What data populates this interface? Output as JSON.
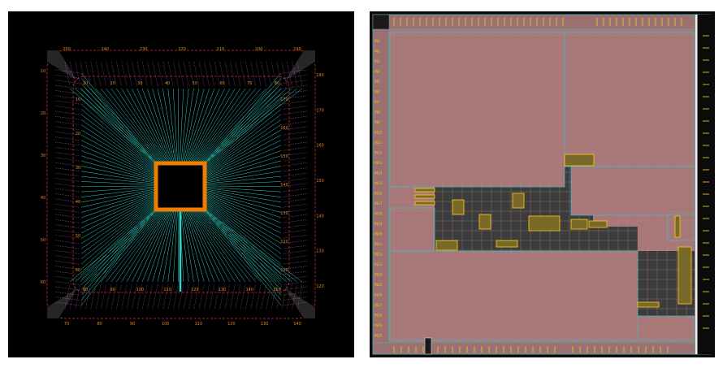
{
  "left_panel": {
    "title": "",
    "colors": {
      "background": "#000000",
      "bond_wire": "#2fd3c8",
      "die": "#f07c00",
      "pad_ring": "#e04040",
      "pin_outline": "#c878c8",
      "label": "#e08a1e"
    },
    "labels": {
      "top_outer": [
        "250",
        "240",
        "230",
        "220",
        "210",
        "200",
        "190"
      ],
      "top_inner": [
        "10",
        "20",
        "30",
        "40",
        "50",
        "60",
        "70",
        "80"
      ],
      "bottom_outer": [
        "70",
        "80",
        "90",
        "100",
        "110",
        "120",
        "130",
        "140"
      ],
      "bottom_inner": [
        "80",
        "90",
        "100",
        "110",
        "120",
        "130",
        "140",
        "150"
      ],
      "left_outer": [
        "10",
        "20",
        "30",
        "40",
        "50",
        "60"
      ],
      "left_inner": [
        "10",
        "20",
        "30",
        "40",
        "50",
        "60"
      ],
      "right_outer": [
        "180",
        "170",
        "160",
        "150",
        "140",
        "130",
        "120"
      ],
      "right_inner": [
        "170",
        "160",
        "150",
        "140",
        "130",
        "120",
        "110"
      ]
    }
  },
  "right_panel": {
    "title": "",
    "colors": {
      "background": "#0b0b0b",
      "macro_fill": "#a87878",
      "core_fill": "#3c3c3c",
      "outline": "#3fb8c8",
      "cell": "#f0c020"
    },
    "pin_labels_left": [
      "IN1",
      "IN2",
      "IN3",
      "IN4",
      "IN5",
      "IN6",
      "IN7",
      "IN8",
      "IN9",
      "IN10",
      "IN11",
      "IN12",
      "IN13",
      "IN14",
      "IN15",
      "IN16",
      "IN17",
      "IN18",
      "IN19",
      "IN20",
      "IN21",
      "IN22",
      "IN23",
      "IN24",
      "IN25",
      "IN26",
      "IN27",
      "IN28",
      "IN29",
      "IN30"
    ]
  }
}
